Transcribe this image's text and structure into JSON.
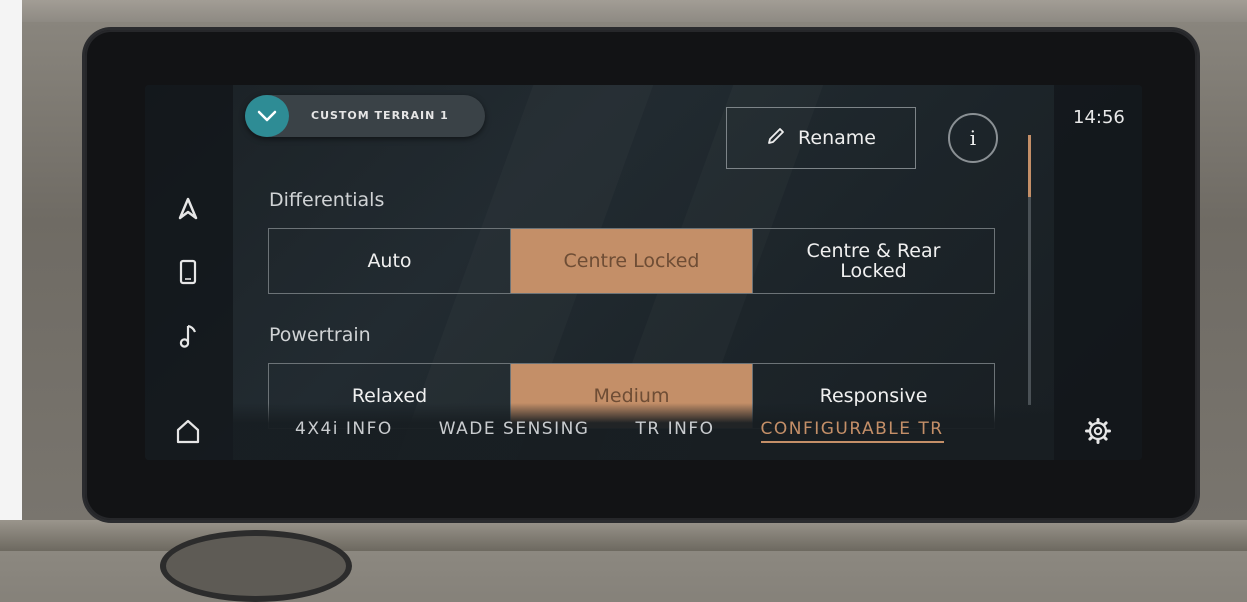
{
  "status": {
    "time": "14:56"
  },
  "header": {
    "terrain_label": "CUSTOM TERRAIN 1",
    "rename_label": "Rename",
    "info_label": "i"
  },
  "sections": [
    {
      "title": "Differentials",
      "options": [
        "Auto",
        "Centre Locked",
        "Centre & Rear Locked"
      ],
      "selected": "Centre Locked"
    },
    {
      "title": "Powertrain",
      "options": [
        "Relaxed",
        "Medium",
        "Responsive"
      ],
      "selected": "Medium"
    }
  ],
  "tabs": [
    "4X4i INFO",
    "WADE SENSING",
    "TR INFO",
    "CONFIGURABLE TR"
  ],
  "active_tab": "CONFIGURABLE TR",
  "icons": {
    "nav": [
      "navigation-icon",
      "phone-icon",
      "music-icon",
      "home-icon"
    ],
    "settings": "gear-icon",
    "edit": "pencil-icon",
    "terrain_toggle": "chevron-down-icon"
  },
  "colors": {
    "accent": "#c48f68",
    "teal": "#2e8c95",
    "background": "#1e262b"
  }
}
